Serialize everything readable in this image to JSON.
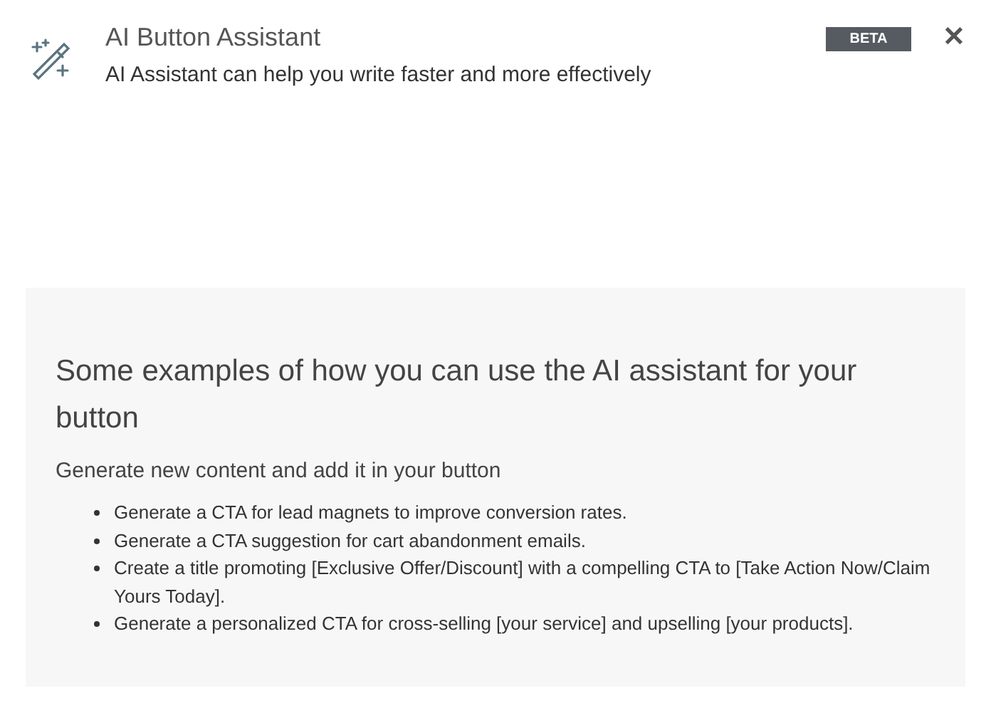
{
  "header": {
    "title": "AI Button Assistant",
    "subtitle": "AI Assistant can help you write faster and more effectively",
    "badge": "BETA",
    "close": "✕"
  },
  "examples": {
    "heading": "Some examples of how you can use the AI assistant for your button",
    "subheading": "Generate new content and add it in your button",
    "items": [
      "Generate a CTA for lead magnets to improve conversion rates.",
      "Generate a CTA suggestion for cart abandonment emails.",
      "Create a title promoting [Exclusive Offer/Discount] with a compelling CTA to [Take Action Now/Claim Yours Today].",
      "Generate a personalized CTA for cross-selling [your service] and upselling [your products]."
    ]
  }
}
